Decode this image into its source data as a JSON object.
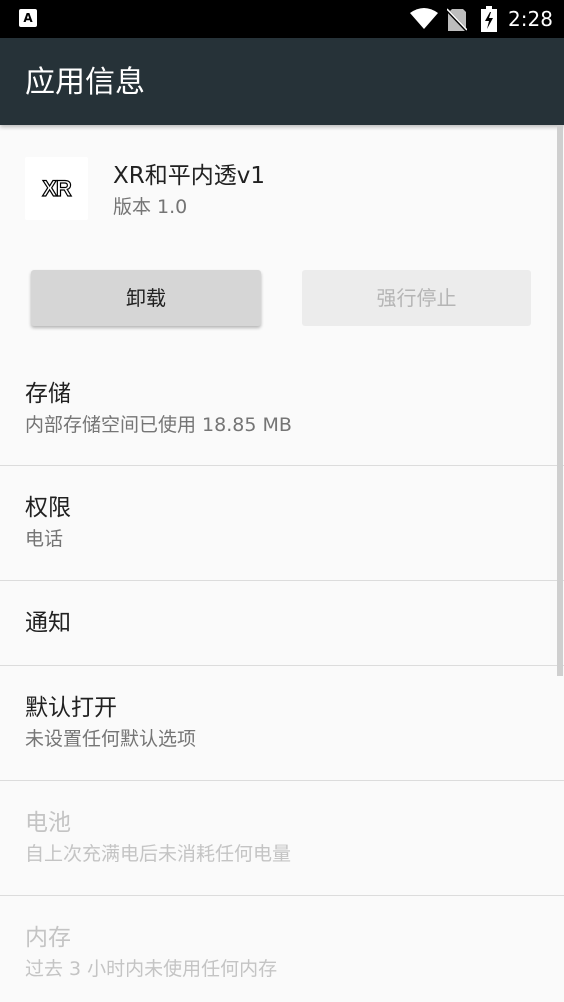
{
  "status_bar": {
    "notification_icon": "app-notification-icon",
    "notification_glyph": "A",
    "wifi_icon": "wifi-icon",
    "sim_icon": "no-sim-icon",
    "battery_icon": "battery-charging-icon",
    "time": "2:28"
  },
  "app_bar": {
    "title": "应用信息",
    "background": "#263238"
  },
  "app": {
    "logo_text": "XR",
    "name": "XR和平内透v1",
    "version": "版本 1.0"
  },
  "buttons": {
    "uninstall": "卸载",
    "force_stop": "强行停止"
  },
  "rows": {
    "storage": {
      "title": "存储",
      "subtitle": "内部存储空间已使用 18.85 MB"
    },
    "permissions": {
      "title": "权限",
      "subtitle": "电话"
    },
    "notifications": {
      "title": "通知"
    },
    "open_by_default": {
      "title": "默认打开",
      "subtitle": "未设置任何默认选项"
    },
    "battery": {
      "title": "电池",
      "subtitle": "自上次充满电后未消耗任何电量"
    },
    "memory": {
      "title": "内存",
      "subtitle": "过去 3 小时内未使用任何内存"
    }
  }
}
